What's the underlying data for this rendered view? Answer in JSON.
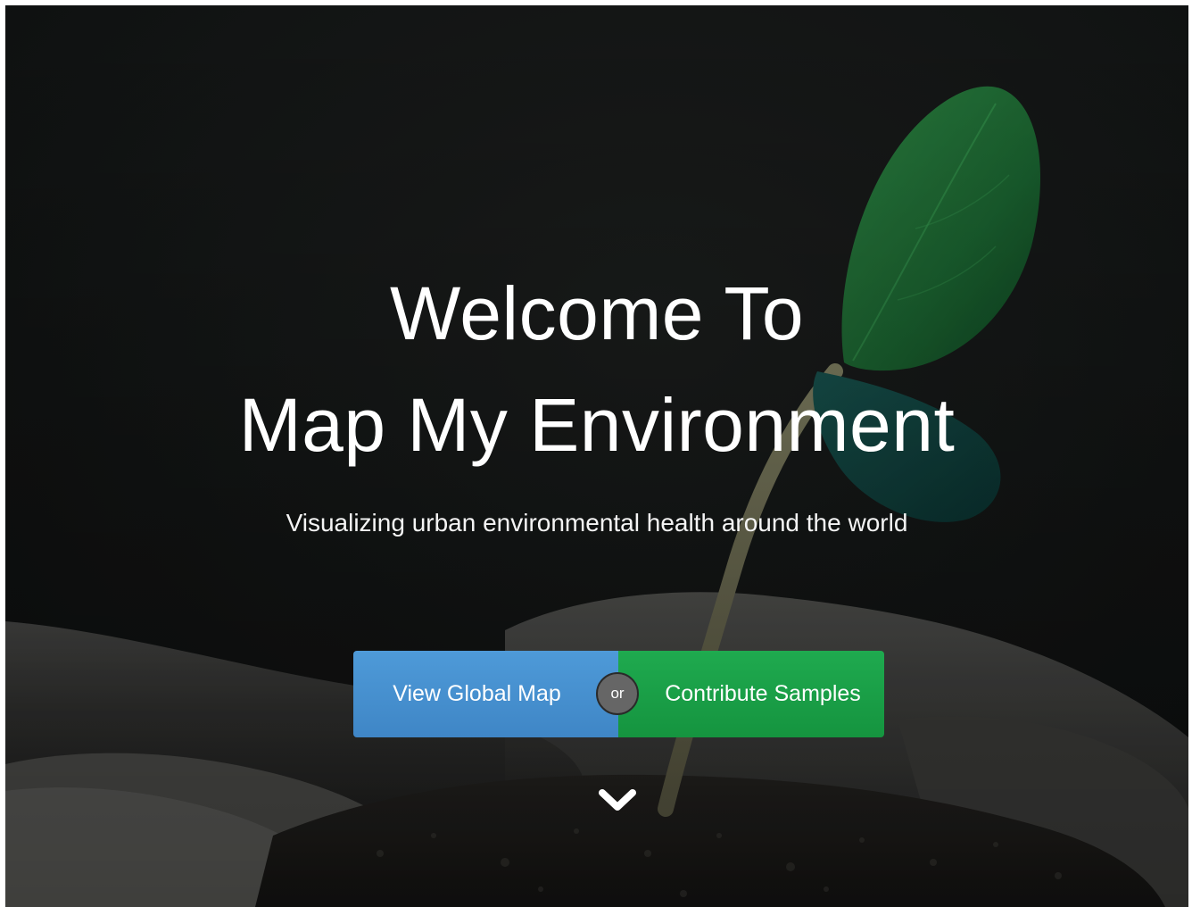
{
  "hero": {
    "title_line_1": "Welcome To",
    "title_line_2": "Map My Environment",
    "subtitle": "Visualizing urban environmental health around the world"
  },
  "actions": {
    "view_map_label": "View Global Map",
    "separator_label": "or",
    "contribute_label": "Contribute Samples"
  },
  "scroll": {
    "icon": "chevron-down-icon"
  },
  "colors": {
    "view_map_button": "#4a93d2",
    "contribute_button": "#1aa048",
    "separator_badge": "#666666",
    "hero_overlay": "#151716",
    "leaf_green": "#1f7a3a"
  }
}
